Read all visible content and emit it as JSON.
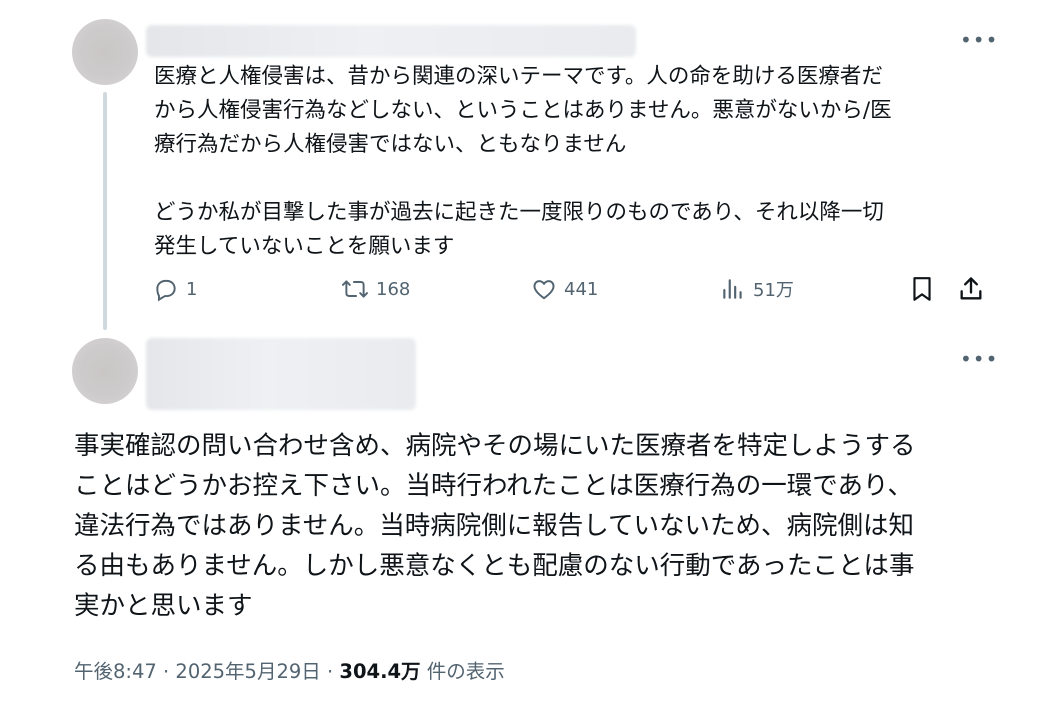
{
  "tweet1": {
    "more_label": "•••",
    "text": "医療と人権侵害は、昔から関連の深いテーマです。人の命を助ける医療者だ\nから人権侵害行為などしない、ということはありません。悪意がないから/医\n療行為だから人権侵害ではない、ともなりません\n\nどうか私が目撃した事が過去に起きた一度限りのものであり、それ以降一切\n発生していないことを願います",
    "reply_count": "1",
    "retweet_count": "168",
    "like_count": "441",
    "view_count": "51万"
  },
  "tweet2": {
    "more_label": "•••",
    "text": "事実確認の問い合わせ含め、病院やその場にいた医療者を特定しようする\nことはどうかお控え下さい。当時行われたことは医療行為の一環であり、\n違法行為ではありません。当時病院側に報告していないため、病院側は知\nる由もありません。しかし悪意なくとも配慮のない行動であったことは事\n実かと思います",
    "time": "午後8:47",
    "separator": " · ",
    "date": "2025年5月29日",
    "separator2": " · ",
    "views": "304.4万",
    "views_label": " 件の表示"
  },
  "icons": [
    "more-icon",
    "reply-icon",
    "retweet-icon",
    "like-icon",
    "views-icon",
    "bookmark-icon",
    "share-icon"
  ],
  "colors": {
    "text": "#0f1419",
    "secondary": "#536471",
    "thread_line": "#cfd9de"
  }
}
